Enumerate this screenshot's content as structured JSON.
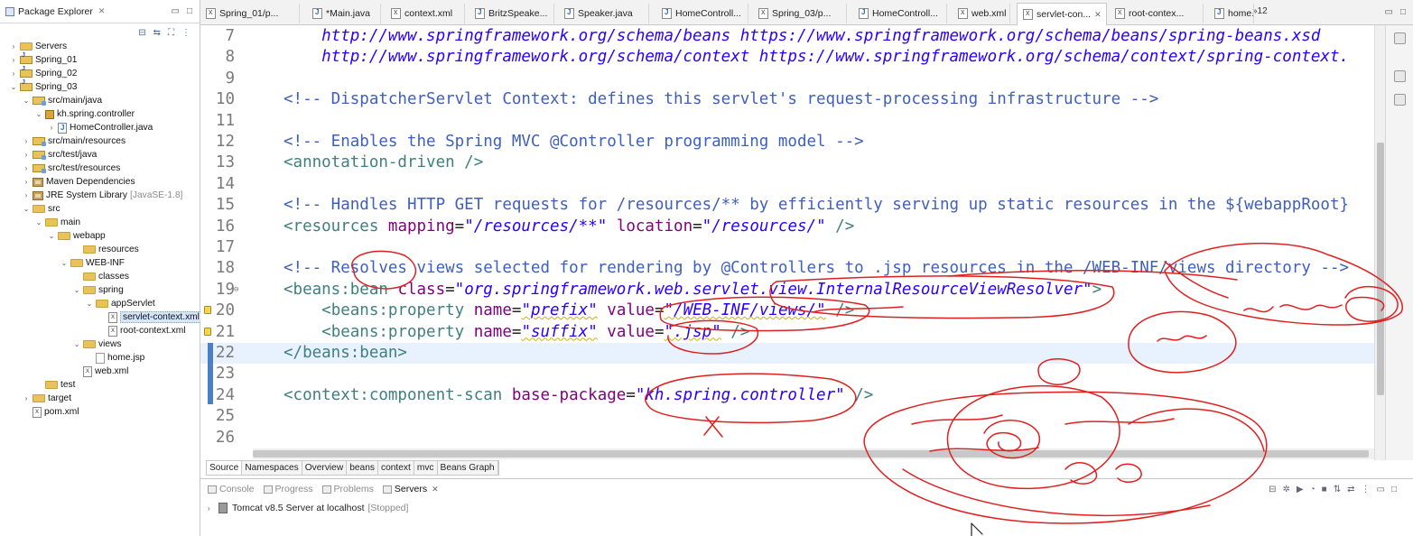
{
  "package_explorer": {
    "title": "Package Explorer",
    "items": [
      {
        "label": "Servers",
        "icon": "folder-icon",
        "twisty": "collapsed"
      },
      {
        "label": "Spring_01",
        "icon": "project-icon",
        "twisty": "collapsed"
      },
      {
        "label": "Spring_02",
        "icon": "project-icon",
        "twisty": "collapsed"
      },
      {
        "label": "Spring_03",
        "icon": "project-icon",
        "twisty": "expanded"
      },
      {
        "label": "src/main/java",
        "icon": "source-folder-icon",
        "twisty": "expanded"
      },
      {
        "label": "kh.spring.controller",
        "icon": "package-icon",
        "twisty": "expanded"
      },
      {
        "label": "HomeController.java",
        "icon": "java-file-icon",
        "twisty": "collapsed"
      },
      {
        "label": "src/main/resources",
        "icon": "source-folder-icon",
        "twisty": "collapsed"
      },
      {
        "label": "src/test/java",
        "icon": "source-folder-icon",
        "twisty": "collapsed"
      },
      {
        "label": "src/test/resources",
        "icon": "source-folder-icon",
        "twisty": "collapsed"
      },
      {
        "label": "Maven Dependencies",
        "icon": "library-icon",
        "twisty": "collapsed"
      },
      {
        "label": "JRE System Library",
        "decor": "[JavaSE-1.8]",
        "icon": "library-icon",
        "twisty": "collapsed"
      },
      {
        "label": "src",
        "icon": "folder-icon",
        "twisty": "expanded"
      },
      {
        "label": "main",
        "icon": "folder-icon",
        "twisty": "expanded"
      },
      {
        "label": "webapp",
        "icon": "folder-icon",
        "twisty": "expanded"
      },
      {
        "label": "resources",
        "icon": "folder-icon",
        "twisty": "none"
      },
      {
        "label": "WEB-INF",
        "icon": "folder-icon",
        "twisty": "expanded"
      },
      {
        "label": "classes",
        "icon": "folder-icon",
        "twisty": "none"
      },
      {
        "label": "spring",
        "icon": "folder-icon",
        "twisty": "expanded"
      },
      {
        "label": "appServlet",
        "icon": "folder-icon",
        "twisty": "expanded"
      },
      {
        "label": "servlet-context.xml",
        "icon": "xml-file-icon",
        "twisty": "none",
        "selected": true
      },
      {
        "label": "root-context.xml",
        "icon": "xml-file-icon",
        "twisty": "none"
      },
      {
        "label": "views",
        "icon": "folder-icon",
        "twisty": "expanded"
      },
      {
        "label": "home.jsp",
        "icon": "jsp-file-icon",
        "twisty": "none"
      },
      {
        "label": "web.xml",
        "icon": "xml-file-icon",
        "twisty": "none"
      },
      {
        "label": "test",
        "icon": "folder-icon",
        "twisty": "none"
      },
      {
        "label": "target",
        "icon": "folder-icon",
        "twisty": "collapsed"
      },
      {
        "label": "pom.xml",
        "icon": "xml-file-icon",
        "twisty": "none"
      }
    ]
  },
  "editor_tabs": [
    {
      "label": "Spring_01/p...",
      "icon": "xml"
    },
    {
      "label": "*Main.java",
      "icon": "java"
    },
    {
      "label": "context.xml",
      "icon": "xml"
    },
    {
      "label": "BritzSpeake...",
      "icon": "java"
    },
    {
      "label": "Speaker.java",
      "icon": "java"
    },
    {
      "label": "HomeControll...",
      "icon": "java"
    },
    {
      "label": "Spring_03/p...",
      "icon": "xml"
    },
    {
      "label": "HomeControll...",
      "icon": "java"
    },
    {
      "label": "web.xml",
      "icon": "xml"
    },
    {
      "label": "servlet-con...",
      "icon": "xml",
      "active": true
    },
    {
      "label": "root-contex...",
      "icon": "xml"
    },
    {
      "label": "home.jsp",
      "icon": "java"
    }
  ],
  "editor_tabs_overflow": "»12",
  "code_lines": [
    {
      "n": "7",
      "segments": [
        {
          "t": "    ",
          "c": ""
        },
        {
          "t": "http://www.springframework.org/schema/beans https://www.springframework.org/schema/beans/spring-beans.xsd",
          "c": "url"
        }
      ]
    },
    {
      "n": "8",
      "segments": [
        {
          "t": "    ",
          "c": ""
        },
        {
          "t": "http://www.springframework.org/schema/context https://www.springframework.org/schema/context/spring-context.",
          "c": "url"
        }
      ]
    },
    {
      "n": "9",
      "segments": []
    },
    {
      "n": "10",
      "segments": [
        {
          "t": "<!-- DispatcherServlet Context: defines this servlet's request-processing infrastructure -->",
          "c": "comment"
        }
      ]
    },
    {
      "n": "11",
      "segments": []
    },
    {
      "n": "12",
      "segments": [
        {
          "t": "<!-- Enables the Spring MVC @Controller programming model -->",
          "c": "comment"
        }
      ]
    },
    {
      "n": "13",
      "segments": [
        {
          "t": "<annotation-driven />",
          "c": "tag"
        }
      ]
    },
    {
      "n": "14",
      "segments": []
    },
    {
      "n": "15",
      "segments": [
        {
          "t": "<!-- Handles HTTP GET requests for /resources/** by efficiently serving up static resources in the ${webappRoot}",
          "c": "comment"
        }
      ]
    },
    {
      "n": "16",
      "segments": [
        {
          "t": "<resources ",
          "c": "tag"
        },
        {
          "t": "mapping",
          "c": "attr"
        },
        {
          "t": "=",
          "c": ""
        },
        {
          "t": "\"/resources/**\"",
          "c": "val"
        },
        {
          "t": " ",
          "c": ""
        },
        {
          "t": "location",
          "c": "attr"
        },
        {
          "t": "=",
          "c": ""
        },
        {
          "t": "\"/resources/\"",
          "c": "val"
        },
        {
          "t": " />",
          "c": "tag"
        }
      ]
    },
    {
      "n": "17",
      "segments": []
    },
    {
      "n": "18",
      "segments": [
        {
          "t": "<!-- Resolves views selected for rendering by @Controllers to .jsp resources in the /WEB-INF/views directory -->",
          "c": "comment"
        }
      ]
    },
    {
      "n": "19",
      "fold": true,
      "segments": [
        {
          "t": "<beans:bean ",
          "c": "tag"
        },
        {
          "t": "class",
          "c": "attr"
        },
        {
          "t": "=",
          "c": ""
        },
        {
          "t": "\"org.springframework.web.servlet.view.InternalResourceViewResolver\"",
          "c": "val"
        },
        {
          "t": ">",
          "c": "tag"
        }
      ]
    },
    {
      "n": "20",
      "mark": true,
      "segments": [
        {
          "t": "    ",
          "c": ""
        },
        {
          "t": "<beans:property ",
          "c": "tag"
        },
        {
          "t": "name",
          "c": "attr"
        },
        {
          "t": "=",
          "c": ""
        },
        {
          "t": "\"prefix\"",
          "c": "val squig"
        },
        {
          "t": " ",
          "c": ""
        },
        {
          "t": "value",
          "c": "attr"
        },
        {
          "t": "=",
          "c": ""
        },
        {
          "t": "\"/WEB-INF/views/\"",
          "c": "val squig"
        },
        {
          "t": " />",
          "c": "tag"
        }
      ]
    },
    {
      "n": "21",
      "mark": true,
      "segments": [
        {
          "t": "    ",
          "c": ""
        },
        {
          "t": "<beans:property ",
          "c": "tag"
        },
        {
          "t": "name",
          "c": "attr"
        },
        {
          "t": "=",
          "c": ""
        },
        {
          "t": "\"suffix\"",
          "c": "val squig"
        },
        {
          "t": " ",
          "c": ""
        },
        {
          "t": "value",
          "c": "attr"
        },
        {
          "t": "=",
          "c": ""
        },
        {
          "t": "\".jsp\"",
          "c": "val squig"
        },
        {
          "t": " />",
          "c": "tag"
        }
      ]
    },
    {
      "n": "22",
      "current": true,
      "segments": [
        {
          "t": "</beans:bean>",
          "c": "tag"
        }
      ]
    },
    {
      "n": "23",
      "segments": []
    },
    {
      "n": "24",
      "segments": [
        {
          "t": "<context:component-scan ",
          "c": "tag"
        },
        {
          "t": "base-package",
          "c": "attr"
        },
        {
          "t": "=",
          "c": ""
        },
        {
          "t": "\"kh.spring.controller\"",
          "c": "val"
        },
        {
          "t": " />",
          "c": "tag"
        }
      ]
    },
    {
      "n": "25",
      "segments": []
    },
    {
      "n": "26",
      "segments": []
    }
  ],
  "editor_bottom_tabs": [
    "Source",
    "Namespaces",
    "Overview",
    "beans",
    "context",
    "mvc",
    "Beans Graph"
  ],
  "bottom_view": {
    "tabs": [
      {
        "label": "Console",
        "active": false
      },
      {
        "label": "Progress",
        "active": false
      },
      {
        "label": "Problems",
        "active": false
      },
      {
        "label": "Servers",
        "active": true
      }
    ],
    "server": {
      "label": "Tomcat v8.5 Server at localhost",
      "status": "[Stopped]"
    }
  },
  "colors": {
    "comment": "#3f5fbf",
    "tag": "#3f7f7f",
    "attr": "#7f007f",
    "value": "#2a00ff",
    "annotation_ink": "#e02020"
  }
}
